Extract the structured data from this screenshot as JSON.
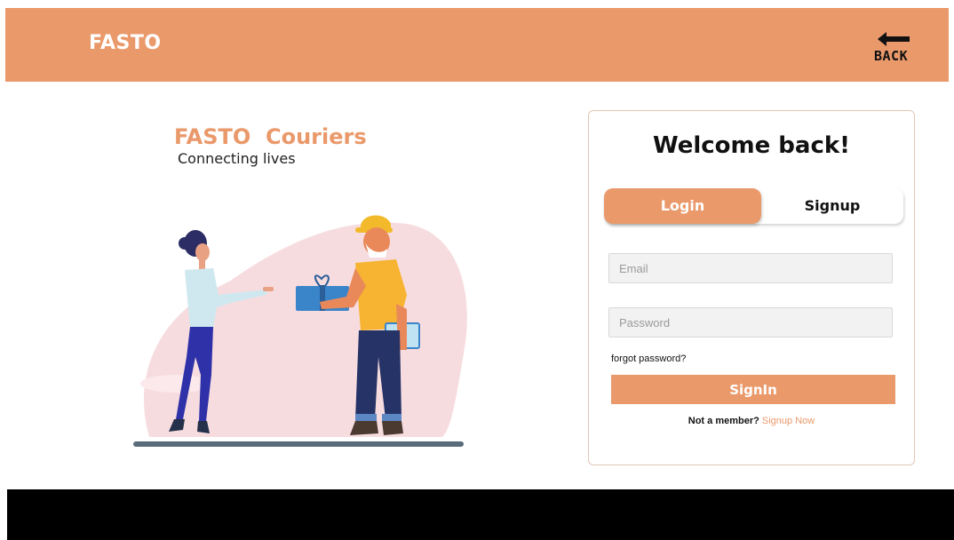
{
  "header": {
    "brand": "FASTO",
    "back_label": "BACK",
    "back_icon": "left-arrow-icon"
  },
  "hero": {
    "title": "FASTO  Couriers",
    "subtitle": "Connecting lives"
  },
  "card": {
    "title": "Welcome back!",
    "tabs": [
      {
        "label": "Login",
        "active": true
      },
      {
        "label": "Signup",
        "active": false
      }
    ],
    "email_placeholder": "Email",
    "password_placeholder": "Password",
    "forgot_label": "forgot password?",
    "signin_label": "SignIn",
    "member_text": "Not a member?",
    "signup_link": "Signup Now"
  },
  "colors": {
    "accent": "#ea996b",
    "footer": "#000000",
    "blob": "#f7dcdf"
  }
}
